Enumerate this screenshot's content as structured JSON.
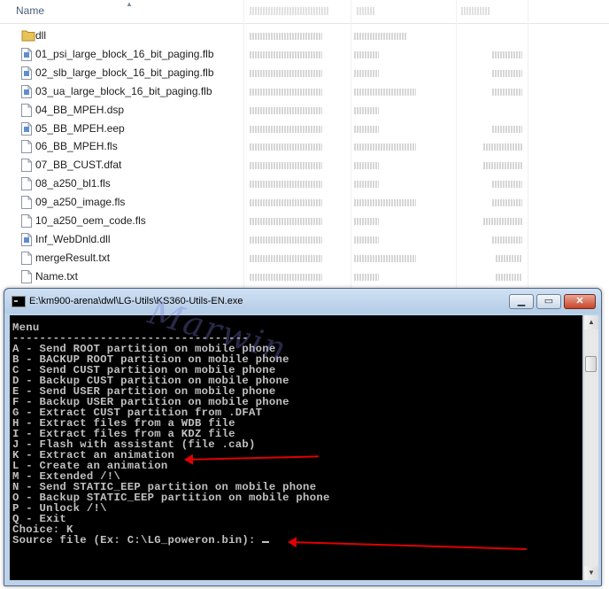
{
  "explorer": {
    "column_name": "Name",
    "files": [
      {
        "name": "dll",
        "type": "folder"
      },
      {
        "name": "01_psi_large_block_16_bit_paging.flb",
        "type": "file-blue"
      },
      {
        "name": "02_slb_large_block_16_bit_paging.flb",
        "type": "file-blue"
      },
      {
        "name": "03_ua_large_block_16_bit_paging.flb",
        "type": "file-blue"
      },
      {
        "name": "04_BB_MPEH.dsp",
        "type": "file"
      },
      {
        "name": "05_BB_MPEH.eep",
        "type": "file-blue"
      },
      {
        "name": "06_BB_MPEH.fls",
        "type": "file"
      },
      {
        "name": "07_BB_CUST.dfat",
        "type": "file"
      },
      {
        "name": "08_a250_bl1.fls",
        "type": "file"
      },
      {
        "name": "09_a250_image.fls",
        "type": "file"
      },
      {
        "name": "10_a250_oem_code.fls",
        "type": "file"
      },
      {
        "name": "Inf_WebDnld.dll",
        "type": "file-blue"
      },
      {
        "name": "mergeResult.txt",
        "type": "file"
      },
      {
        "name": "Name.txt",
        "type": "file"
      }
    ]
  },
  "console_window": {
    "title": "E:\\km900-arena\\dwl\\LG-Utils\\KS360-Utils-EN.exe",
    "minimize_glyph": "▁",
    "maximize_glyph": "▭",
    "close_glyph": "✕",
    "lines": [
      "Menu",
      "-----------------------------------",
      "A - Send ROOT partition on mobile phone",
      "B - BACKUP ROOT partition on mobile phone",
      "C - Send CUST partition on mobile phone",
      "D - Backup CUST partition on mobile phone",
      "E - Send USER partition on mobile phone",
      "F - Backup USER partition on mobile phone",
      "G - Extract CUST partition from .DFAT",
      "H - Extract files from a WDB file",
      "I - Extract files from a KDZ file",
      "J - Flash with assistant (file .cab)",
      "K - Extract an animation",
      "L - Create an animation",
      "M - Extended /!\\",
      "N - Send STATIC_EEP partition on mobile phone",
      "O - Backup STATIC_EEP partition on mobile phone",
      "P - Unlock /!\\",
      "Q - Exit",
      "Choice: K"
    ],
    "prompt": "Source file (Ex: C:\\LG_poweron.bin): "
  },
  "watermark": "Marwin",
  "colors": {
    "console_bg": "#000000",
    "console_text": "#c0c0c0",
    "annotation_arrow": "#e10000",
    "titlebar": "#bcd2ea"
  }
}
